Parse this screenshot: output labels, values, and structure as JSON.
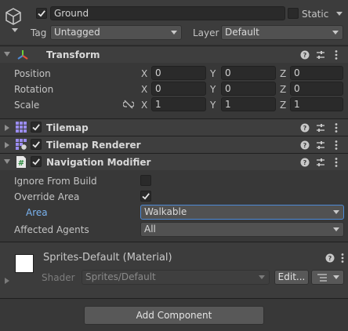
{
  "gameobject": {
    "name": "Ground",
    "active": true,
    "static_label": "Static",
    "static_checked": false,
    "tag_label": "Tag",
    "tag_value": "Untagged",
    "layer_label": "Layer",
    "layer_value": "Default"
  },
  "transform": {
    "title": "Transform",
    "rows": [
      {
        "label": "Position",
        "x": "0",
        "y": "0",
        "z": "0"
      },
      {
        "label": "Rotation",
        "x": "0",
        "y": "0",
        "z": "0"
      },
      {
        "label": "Scale",
        "x": "1",
        "y": "1",
        "z": "1"
      }
    ],
    "axis_labels": {
      "x": "X",
      "y": "Y",
      "z": "Z"
    }
  },
  "components": {
    "tilemap": {
      "title": "Tilemap",
      "enabled": true
    },
    "tilemap_renderer": {
      "title": "Tilemap Renderer",
      "enabled": true
    },
    "navigation_modifier": {
      "title": "Navigation Modifier",
      "enabled": true,
      "ignore_from_build_label": "Ignore From Build",
      "ignore_from_build": false,
      "override_area_label": "Override Area",
      "override_area": true,
      "area_label": "Area",
      "area_value": "Walkable",
      "affected_agents_label": "Affected Agents",
      "affected_agents_value": "All"
    }
  },
  "material": {
    "name": "Sprites-Default (Material)",
    "shader_label": "Shader",
    "shader_value": "Sprites/Default",
    "edit_label": "Edit...",
    "swatch_color": "#ffffff"
  },
  "add_component_label": "Add Component",
  "colors": {
    "panel_bg": "#383838",
    "header_bg": "#3e3e3e",
    "accent": "#4d8ad6",
    "area_label_color": "#7ab3f0"
  },
  "icons": {
    "gameobject": "cube-icon",
    "transform": "transform-axes-icon",
    "tilemap": "tilemap-grid-icon",
    "tilemap_renderer": "tilemap-renderer-icon",
    "navigation_modifier": "hash-icon",
    "help": "question-icon",
    "preset": "sliders-icon",
    "menu": "kebab-icon",
    "constrain": "link-broken-icon"
  }
}
